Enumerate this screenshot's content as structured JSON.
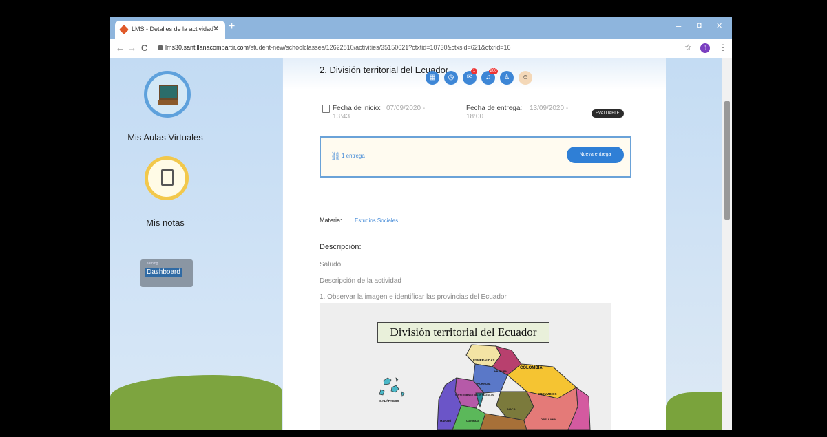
{
  "browser": {
    "tab_title": "LMS - Detalles de la actividad",
    "tab_close": "✕",
    "new_tab": "+",
    "url_host": "lms30.santillanacompartir.com",
    "url_path": "/student-new/schoolclasses/12622810/activities/35150621?ctxtid=10730&ctxsid=621&ctxrid=16",
    "profile_initial": "J",
    "minimize": "–",
    "restore": "◘",
    "close": "✕",
    "back": "←",
    "forward": "→",
    "reload": "C",
    "star": "☆",
    "menu": "⋮"
  },
  "sidebar": {
    "aulas_label": "Mis Aulas Virtuales",
    "notas_label": "Mis notas",
    "dashboard_small": "Learning",
    "dashboard_label": "Dashboard"
  },
  "activity": {
    "title": "2. División territorial del Ecuador",
    "fecha_inicio_label": "Fecha de inicio:",
    "fecha_inicio_date": "07/09/2020 -",
    "fecha_inicio_time": "13:43",
    "fecha_entrega_label": "Fecha de entrega:",
    "fecha_entrega_date": "13/09/2020 -",
    "fecha_entrega_time": "18:00",
    "evaluable": "EVALUABLE",
    "entregas": "1 entrega",
    "nueva_entrega": "Nueva entrega",
    "materia_label": "Materia:",
    "materia_value": "Estudios Sociales",
    "descripcion_label": "Descripción:",
    "desc_line1": "Saludo",
    "desc_line2": "Descripción de la actividad",
    "desc_line3": "1. Observar la imagen e identificar las provincias del Ecuador"
  },
  "header_icons": {
    "messages_badge": "1",
    "notifications_badge": "200"
  },
  "map": {
    "title": "División territorial del Ecuador",
    "labels": {
      "colombia": "COLOMBIA",
      "esmeraldas": "ESMERALDAS",
      "galapagos": "GALÁPAGOS",
      "sucumbios": "SUCUMBÍOS",
      "imbabura": "IMBABURA",
      "pichincha": "PICHINCHA",
      "santo_domingo": "SANTO DOMINGO DE LOS TSÁCHILAS",
      "manabi": "MANABÍ",
      "napo": "NAPO",
      "orellana": "ORELLANA",
      "cotopaxi": "COTOPAXI"
    }
  },
  "colors": {
    "accent": "#2f7fd6",
    "tab_bar": "#8eb5dd"
  }
}
